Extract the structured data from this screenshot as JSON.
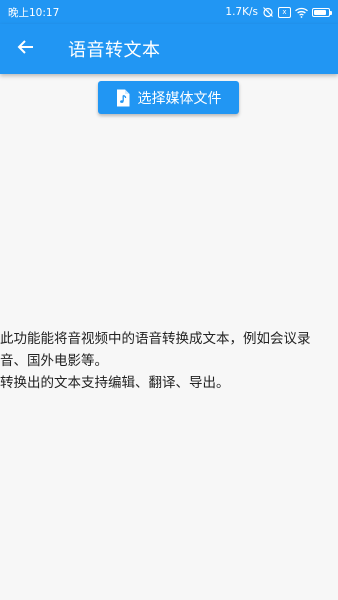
{
  "status_bar": {
    "time": "晚上10:17",
    "network_speed": "1.7K/s",
    "sim_label": "x",
    "battery_level": 0.85,
    "icons": [
      "alarm-off-icon",
      "sim-icon",
      "wifi-icon",
      "battery-icon"
    ]
  },
  "app_bar": {
    "back_icon": "arrow-left-icon",
    "title": "语音转文本"
  },
  "select_button": {
    "icon": "music-file-icon",
    "label": "选择媒体文件"
  },
  "description": {
    "line1": "此功能能将音视频中的语音转换成文本，例如会议录音、国外电影等。",
    "line2": "转换出的文本支持编辑、翻译、导出。"
  },
  "colors": {
    "primary": "#2196F3",
    "background": "#f7f7f7",
    "text": "#222222"
  }
}
